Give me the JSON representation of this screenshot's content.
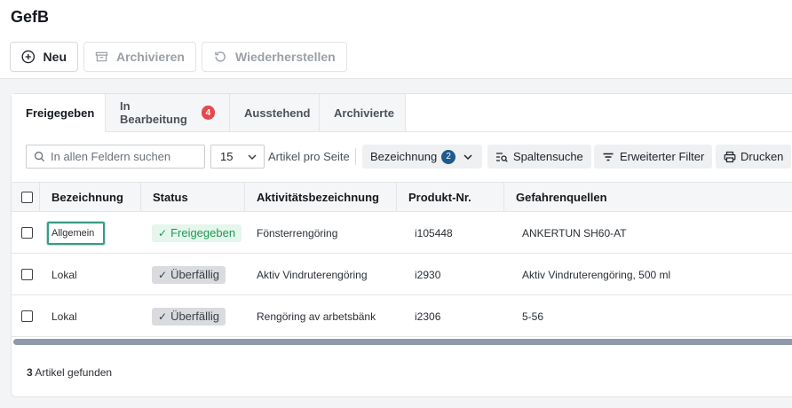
{
  "page": {
    "title": "GefB"
  },
  "toolbar": {
    "new_label": "Neu",
    "archive_label": "Archivieren",
    "restore_label": "Wiederherstellen"
  },
  "tabs": [
    {
      "label": "Freigegeben",
      "selected": true
    },
    {
      "label": "In Bearbeitung",
      "count": "4"
    },
    {
      "label": "Ausstehend"
    },
    {
      "label": "Archivierte"
    }
  ],
  "filters": {
    "search_placeholder": "In allen Feldern suchen",
    "per_page_value": "15",
    "per_page_label": "Artikel pro Seite",
    "sort_label": "Bezeichnung",
    "sort_badge": "2",
    "column_search_label": "Spaltensuche",
    "advanced_filter_label": "Erweiterter Filter",
    "print_label": "Drucken"
  },
  "table": {
    "headers": [
      "Bezeichnung",
      "Status",
      "Aktivitätsbezeichnung",
      "Produkt-Nr.",
      "Gefahrenquellen"
    ],
    "rows": [
      {
        "bezeichnung": "Allgemein",
        "status": "Freigegeben",
        "status_type": "ok",
        "aktivitaet": "Fönsterrengöring",
        "produkt": "i105448",
        "gefahren": "ANKERTUN SH60-AT"
      },
      {
        "bezeichnung": "Lokal",
        "status": "Überfällig",
        "status_type": "late",
        "aktivitaet": "Aktiv Vindruterengöring",
        "produkt": "i2930",
        "gefahren": "Aktiv Vindruterengöring, 500 ml"
      },
      {
        "bezeichnung": "Lokal",
        "status": "Überfällig",
        "status_type": "late",
        "aktivitaet": "Rengöring av arbetsbänk",
        "produkt": "i2306",
        "gefahren": "5-56"
      }
    ]
  },
  "footer": {
    "count": "3",
    "label": "Artikel gefunden"
  },
  "colors": {
    "accent_focus": "#3a9b86",
    "badge_red": "#e5484d",
    "badge_blue": "#1f5a8b",
    "status_ok": "#1f9a54"
  }
}
